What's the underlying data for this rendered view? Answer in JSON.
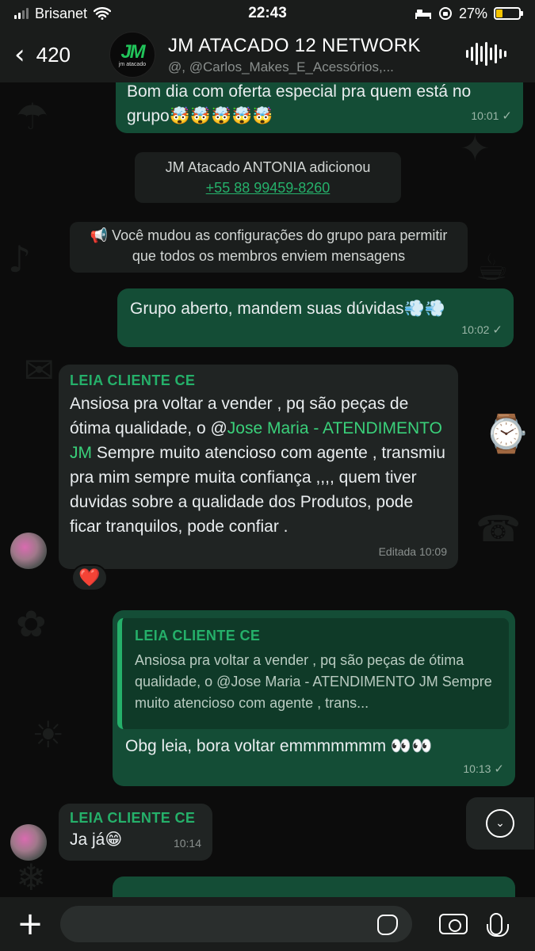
{
  "status_bar": {
    "carrier": "Brisanet",
    "time": "22:43",
    "battery": "27%",
    "battery_level": 0.27
  },
  "header": {
    "back_count": "420",
    "logo_text": "jm atacado",
    "title": "JM ATACADO 12 NETWORK",
    "members": "@, @Carlos_Makes_E_Acessórios,..."
  },
  "messages": {
    "m1": {
      "text": "Bom dia com oferta especial pra quem está no grupo🤯🤯🤯🤯🤯",
      "time": "10:01"
    },
    "sys1": {
      "text": "JM Atacado ANTONIA adicionou",
      "phone": "+55 88 99459-8260"
    },
    "sys2": {
      "text": "📢 Você mudou as configurações do grupo para permitir que todos os membros enviem mensagens"
    },
    "m2": {
      "text": "Grupo aberto, mandem suas dúvidas💨💨",
      "time": "10:02"
    },
    "m3": {
      "sender": "LEIA CLIENTE CE",
      "text_before": "Ansiosa pra voltar a vender , pq são peças de ótima qualidade, o ",
      "mention_at": "@",
      "mention_name": "Jose Maria - ATENDIMENTO JM",
      "text_after": " Sempre muito atencioso com agente , transmiu pra mim sempre muita confiança ,,,, quem tiver duvidas sobre a qualidade dos Produtos, pode ficar tranquilos, pode confiar .",
      "time": "Editada 10:09",
      "reaction": "❤️"
    },
    "m4": {
      "quote_sender": "LEIA CLIENTE CE",
      "quote_text": "Ansiosa pra voltar a vender , pq são peças de ótima qualidade, o @Jose Maria - ATENDIMENTO JM Sempre muito atencioso com agente , trans...",
      "text": "Obg leia, bora voltar emmmmmmm 👀👀",
      "time": "10:13"
    },
    "m5": {
      "sender": "LEIA CLIENTE CE",
      "text": "Ja já😁",
      "time": "10:14"
    }
  },
  "colors": {
    "outgoing": "#144d36",
    "incoming": "#202423",
    "accent": "#25b06a",
    "background": "#0c0c0c"
  },
  "icons": [
    "signal-icon",
    "wifi-icon",
    "bed-icon",
    "orientation-lock-icon",
    "battery-icon",
    "back-chevron-icon",
    "audio-wave-icon",
    "read-tick-icon",
    "heart-reaction",
    "scroll-down-icon",
    "plus-icon",
    "sticker-icon",
    "camera-icon",
    "mic-icon"
  ]
}
